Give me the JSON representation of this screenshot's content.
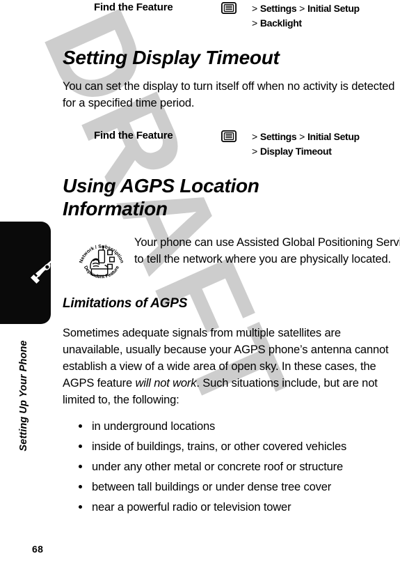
{
  "page": {
    "number": "68",
    "chapter_label": "Setting Up Your Phone",
    "watermark": "DRAFT"
  },
  "find_the_feature_1": {
    "label": "Find the Feature",
    "icon": "menu-icon",
    "lines": [
      {
        "chevron": ">",
        "parts": [
          "Settings",
          "Initial Setup"
        ],
        "text": "> Settings > Initial Setup"
      },
      {
        "chevron": ">",
        "parts": [
          "Backlight"
        ],
        "text": "> Backlight"
      }
    ],
    "line1_a": "Settings",
    "line1_b": "Initial Setup",
    "line2_a": "Backlight"
  },
  "section_display_timeout": {
    "heading": "Setting Display Timeout",
    "paragraph": "You can set the display to turn itself off when no activity is detected for a specified time period."
  },
  "find_the_feature_2": {
    "label": "Find the Feature",
    "icon": "menu-icon",
    "line1_a": "Settings",
    "line1_b": "Initial Setup",
    "line2_a": "Display Timeout"
  },
  "section_agps": {
    "heading": "Using AGPS Location Information",
    "badge": {
      "name": "network-subscription-dependent-feature-badge",
      "top_text": "Network / Subscription",
      "bottom_text": "Dependent Feature"
    },
    "note_paragraph": "Your phone can use Assisted Global Positioning Service (AGPS) to tell the network where you are physically located."
  },
  "section_limitations": {
    "heading": "Limitations of AGPS",
    "paragraph_before_italic": "Sometimes adequate signals from multiple satellites are unavailable, usually because your AGPS phone’s antenna cannot establish a view of a wide area of open sky. In these cases, the AGPS feature ",
    "paragraph_italic": "will not work",
    "paragraph_after_italic": ". Such situations include, but are not limited to, the following:",
    "bullets": [
      "in underground locations",
      "inside of buildings, trains, or other covered vehicles",
      "under any other metal or concrete roof or structure",
      "between tall buildings or under dense tree cover",
      "near a powerful radio or television tower"
    ]
  },
  "colors": {
    "text": "#000000",
    "tab": "#0a0a0a",
    "watermark": "#c9c9c9",
    "page_background": "#ffffff"
  }
}
